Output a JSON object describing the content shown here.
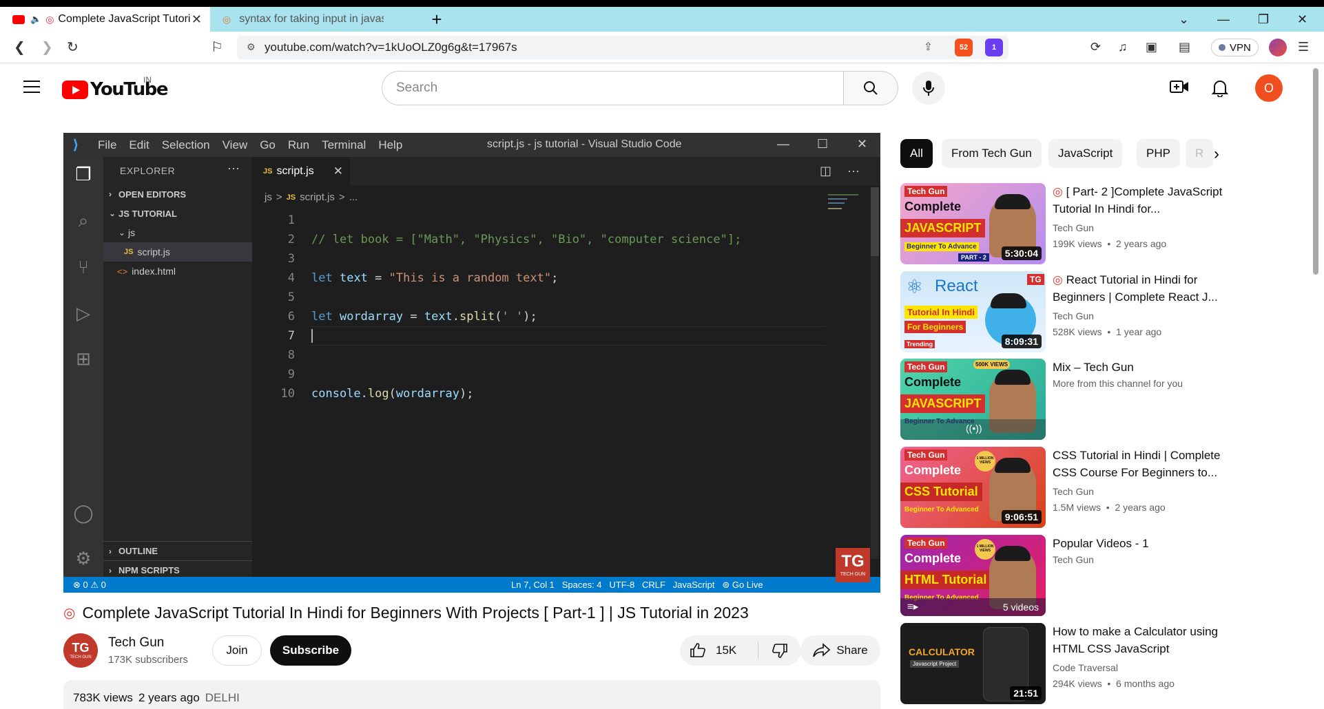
{
  "browser": {
    "tabs": [
      {
        "label": "Complete JavaScript Tutori",
        "active": true
      },
      {
        "label": "syntax for taking input in javascript - B",
        "active": false
      }
    ],
    "new_tab": "+",
    "url": "youtube.com/watch?v=1kUoOLZ0g6g&t=17967s",
    "brave_shield_count": "52",
    "brave_rewards_count": "1",
    "vpn_label": "VPN"
  },
  "masthead": {
    "logo_text": "YouTube",
    "country_code": "IN",
    "search_placeholder": "Search",
    "avatar_letter": "O"
  },
  "vscode": {
    "menu": [
      "File",
      "Edit",
      "Selection",
      "View",
      "Go",
      "Run",
      "Terminal",
      "Help"
    ],
    "window_title": "script.js - js tutorial - Visual Studio Code",
    "explorer": {
      "header": "EXPLORER",
      "open_editors": "OPEN EDITORS",
      "project": "JS TUTORIAL",
      "folder": "js",
      "file_selected": "script.js",
      "file_other": "index.html",
      "outline": "OUTLINE",
      "npm": "NPM SCRIPTS"
    },
    "tab": {
      "badge": "JS",
      "label": "script.js"
    },
    "breadcrumb": [
      "js",
      ">",
      "JS",
      "script.js",
      ">",
      "..."
    ],
    "code_lines": [
      {
        "n": "1",
        "code": ""
      },
      {
        "n": "2",
        "code": "// let book = [\"Math\", \"Physics\", \"Bio\", \"computer science\"];"
      },
      {
        "n": "3",
        "code": ""
      },
      {
        "n": "4",
        "code": "let text = \"This is a random text\";"
      },
      {
        "n": "5",
        "code": ""
      },
      {
        "n": "6",
        "code": "let wordarray = text.split(' ');"
      },
      {
        "n": "7",
        "code": ""
      },
      {
        "n": "8",
        "code": ""
      },
      {
        "n": "9",
        "code": ""
      },
      {
        "n": "10",
        "code": "console.log(wordarray);"
      }
    ],
    "status_left": "⊗ 0 ⚠ 0",
    "status_right": "Ln 7, Col 1   Spaces: 4   UTF-8   CRLF   JavaScript   ⊚ Go Live",
    "watermark": "TG",
    "watermark_sub": "TECH GUN"
  },
  "video": {
    "title": "Complete JavaScript Tutorial In Hindi for Beginners With Projects [ Part-1 ] | JS Tutorial in 2023",
    "channel": "Tech Gun",
    "channel_avatar": "TG",
    "channel_avatar_sub": "TECH GUN",
    "subscribers": "173K subscribers",
    "join": "Join",
    "subscribe": "Subscribe",
    "likes": "15K",
    "share": "Share",
    "views": "783K views",
    "age": "2 years ago",
    "location": "DELHI"
  },
  "chips": [
    "All",
    "From Tech Gun",
    "JavaScript",
    "PHP",
    "R"
  ],
  "recommendations": [
    {
      "title": "[ Part- 2 ]Complete JavaScript Tutorial In Hindi for...",
      "channel": "Tech Gun",
      "meta": "199K views  •  2 years ago",
      "duration": "5:30:04",
      "thumb": {
        "tag": "Tech Gun",
        "line1": "Complete",
        "line2": "JAVASCRIPT",
        "line3": "Beginner To Advance",
        "badge": "PART - 2"
      }
    },
    {
      "title": "React Tutorial in Hindi for Beginners | Complete React J...",
      "channel": "Tech Gun",
      "meta": "528K views  •  1 year ago",
      "duration": "8:09:31",
      "thumb": {
        "tag": "TG",
        "line1": "React",
        "line2": "Tutorial In Hindi",
        "line3": "For Beginners",
        "badge": "Trending"
      }
    },
    {
      "title": "Mix – Tech Gun",
      "channel": "More from this channel for you",
      "meta": "",
      "duration": "",
      "thumb": {
        "tag": "Tech Gun",
        "line1": "Complete",
        "line2": "JAVASCRIPT",
        "line3": "Beginner To Advance",
        "badge": "500K VIEWS"
      }
    },
    {
      "title": "CSS Tutorial in Hindi | Complete CSS Course For Beginners to...",
      "channel": "Tech Gun",
      "meta": "1.5M views  •  2 years ago",
      "duration": "9:06:51",
      "thumb": {
        "tag": "Tech Gun",
        "line1": "Complete",
        "line2": "CSS Tutorial",
        "line3": "Beginner To Advanced",
        "badge": "1 MILLION VIEWS"
      }
    },
    {
      "title": "Popular Videos - 1",
      "channel": "Tech Gun",
      "meta": "",
      "duration": "5 videos",
      "thumb": {
        "tag": "Tech Gun",
        "line1": "Complete",
        "line2": "HTML Tutorial",
        "line3": "Beginner To Advanced",
        "badge": "1 MILLION VIEWS"
      }
    },
    {
      "title": "How to make a Calculator using HTML CSS JavaScript",
      "channel": "Code Traversal",
      "meta": "294K views  •  6 months ago",
      "duration": "21:51",
      "thumb": {
        "tag": "",
        "line1": "CALCULATOR",
        "line2": "Javascript Project",
        "line3": "",
        "badge": ""
      }
    }
  ],
  "colors": {
    "youtube_red": "#ff0000",
    "tabbar": "#a9e3ee",
    "vscode_blue": "#007acc",
    "avatar_orange": "#f04e1f"
  }
}
